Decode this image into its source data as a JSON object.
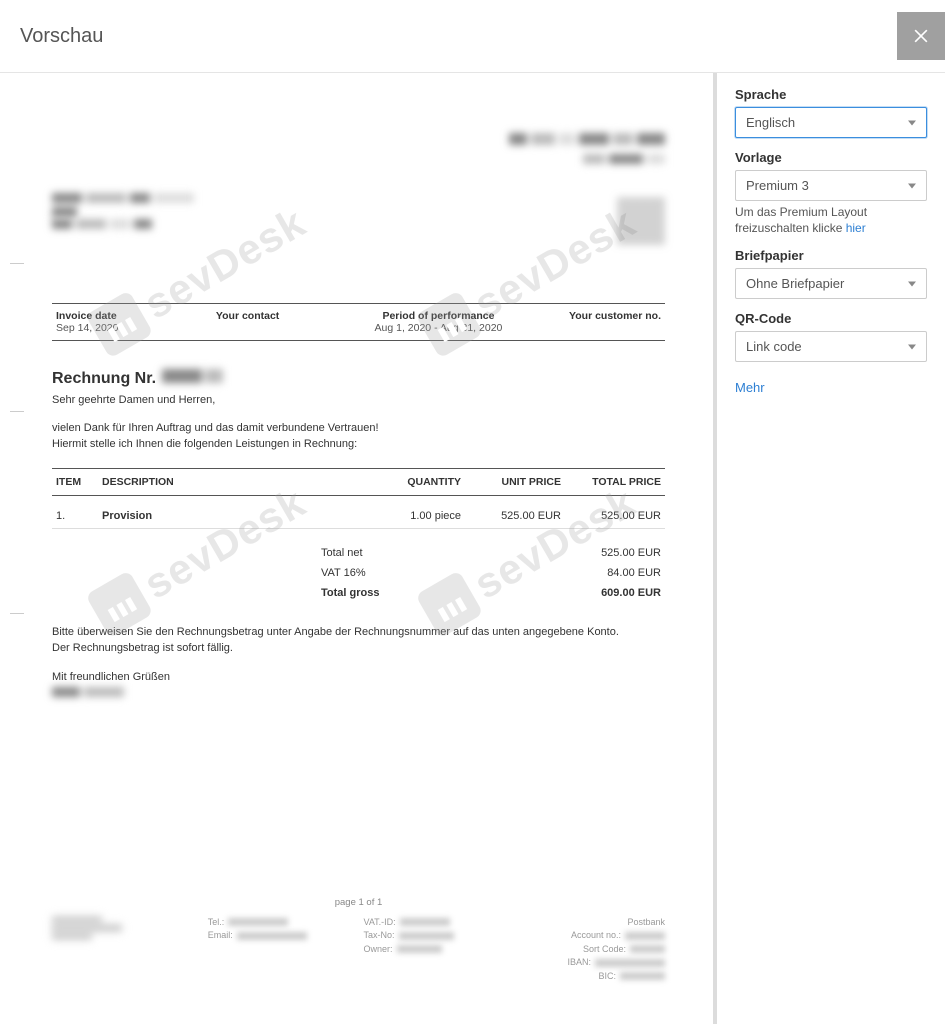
{
  "modal": {
    "title": "Vorschau"
  },
  "sidebar": {
    "language": {
      "label": "Sprache",
      "value": "Englisch"
    },
    "template": {
      "label": "Vorlage",
      "value": "Premium 3",
      "hint_prefix": "Um das Premium Layout freizuschalten klicke ",
      "hint_link": "hier"
    },
    "stationery": {
      "label": "Briefpapier",
      "value": "Ohne Briefpapier"
    },
    "qrcode": {
      "label": "QR-Code",
      "value": "Link code"
    },
    "more": "Mehr"
  },
  "invoice": {
    "watermark_text": "sevDesk",
    "info_bar": {
      "invoice_date_label": "Invoice date",
      "invoice_date_value": "Sep 14, 2020",
      "contact_label": "Your contact",
      "contact_value": "",
      "period_label": "Period of performance",
      "period_value": "Aug 1, 2020 - Aug 31, 2020",
      "customer_no_label": "Your customer no.",
      "customer_no_value": ""
    },
    "title_prefix": "Rechnung Nr.",
    "salutation": "Sehr geehrte Damen und Herren,",
    "intro1": "vielen Dank für Ihren Auftrag und das damit verbundene Vertrauen!",
    "intro2": "Hiermit stelle ich Ihnen die folgenden Leistungen in Rechnung:",
    "table": {
      "headers": {
        "item": "ITEM",
        "desc": "DESCRIPTION",
        "qty": "QUANTITY",
        "unit": "UNIT PRICE",
        "total": "TOTAL PRICE"
      },
      "rows": [
        {
          "item": "1.",
          "desc": "Provision",
          "qty": "1.00 piece",
          "unit": "525.00 EUR",
          "total": "525.00 EUR"
        }
      ]
    },
    "totals": {
      "net_label": "Total net",
      "net_value": "525.00 EUR",
      "vat_label": "VAT 16%",
      "vat_value": "84.00 EUR",
      "gross_label": "Total gross",
      "gross_value": "609.00 EUR"
    },
    "foot_text1": "Bitte überweisen Sie den Rechnungsbetrag unter Angabe der Rechnungsnummer auf das unten angegebene Konto.",
    "foot_text2": "Der Rechnungsbetrag ist sofort fällig.",
    "closing": "Mit freundlichen Grüßen",
    "page_num": "page 1 of 1",
    "footer": {
      "col2": {
        "tel": "Tel.:",
        "email": "Email:"
      },
      "col3": {
        "vat": "VAT.-ID:",
        "tax": "Tax-No:",
        "owner": "Owner:"
      },
      "col4": {
        "bank": "Postbank",
        "acct": "Account no.:",
        "sort": "Sort Code:",
        "iban": "IBAN:",
        "bic": "BIC:"
      }
    }
  }
}
